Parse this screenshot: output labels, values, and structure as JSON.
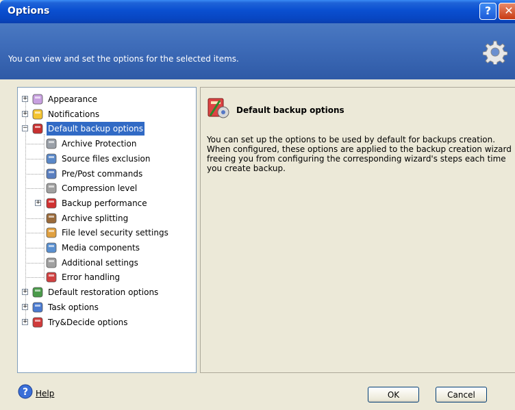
{
  "window": {
    "title": "Options"
  },
  "header": {
    "text": "You can view and set the options for the selected items."
  },
  "tree": {
    "items": [
      {
        "label": "Appearance",
        "expander": "+"
      },
      {
        "label": "Notifications",
        "expander": "+"
      },
      {
        "label": "Default backup options",
        "expander": "−",
        "selected": true
      },
      {
        "label": "Archive Protection"
      },
      {
        "label": "Source files exclusion"
      },
      {
        "label": "Pre/Post commands"
      },
      {
        "label": "Compression level"
      },
      {
        "label": "Backup performance",
        "expander": "+"
      },
      {
        "label": "Archive splitting"
      },
      {
        "label": "File level security settings"
      },
      {
        "label": "Media components"
      },
      {
        "label": "Additional settings"
      },
      {
        "label": "Error handling"
      },
      {
        "label": "Default restoration options",
        "expander": "+"
      },
      {
        "label": "Task options",
        "expander": "+"
      },
      {
        "label": "Try&Decide options",
        "expander": "+"
      }
    ]
  },
  "details": {
    "title": "Default backup options",
    "description": "You can set up the options to be used by default for backups creation. When configured, these options are applied to the backup creation wizard freeing you from configuring the corresponding wizard's steps each time you create backup."
  },
  "footer": {
    "help_label": "Help",
    "ok_label": "OK",
    "cancel_label": "Cancel"
  },
  "colors": {
    "selection": "#316ac5",
    "titlebar": "#0a4fd0",
    "header": "#3e6cb9"
  }
}
